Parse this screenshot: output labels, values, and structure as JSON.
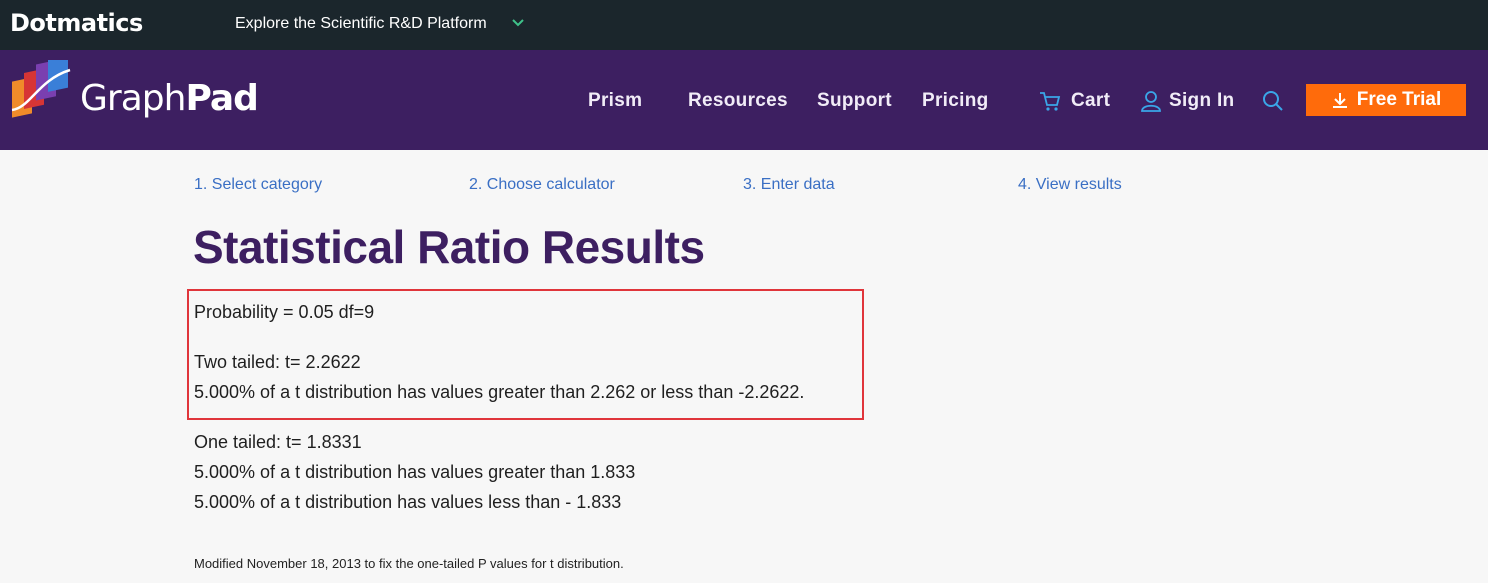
{
  "topbar": {
    "logo": "Dotmatics",
    "explore_label": "Explore the Scientific R&D Platform"
  },
  "nav": {
    "logo_light": "Graph",
    "logo_bold": "Pad",
    "items": [
      "Prism",
      "Resources",
      "Support",
      "Pricing"
    ],
    "cart_label": "Cart",
    "signin_label": "Sign In",
    "trial_label": "Free Trial"
  },
  "steps": [
    "1. Select category",
    "2. Choose calculator",
    "3. Enter data",
    "4. View results"
  ],
  "page_title": "Statistical Ratio Results",
  "results": {
    "probability": "Probability = 0.05 df=9",
    "two_tailed": "Two tailed: t= 2.2622",
    "two_tailed_desc": "5.000% of a t distribution has values greater than 2.262 or less than -2.2622.",
    "one_tailed": "One tailed: t= 1.8331",
    "one_tailed_desc_greater": "5.000% of a t distribution has values greater than 1.833",
    "one_tailed_desc_less": "5.000% of a t distribution has values less than - 1.833"
  },
  "footnote": "Modified November 18, 2013 to fix the one-tailed P values for t distribution.",
  "colors": {
    "topbar": "#1b262c",
    "nav": "#3d1f61",
    "accent_orange": "#ff6b0b",
    "link_blue": "#3a6fc4",
    "highlight_red": "#e0353b"
  }
}
